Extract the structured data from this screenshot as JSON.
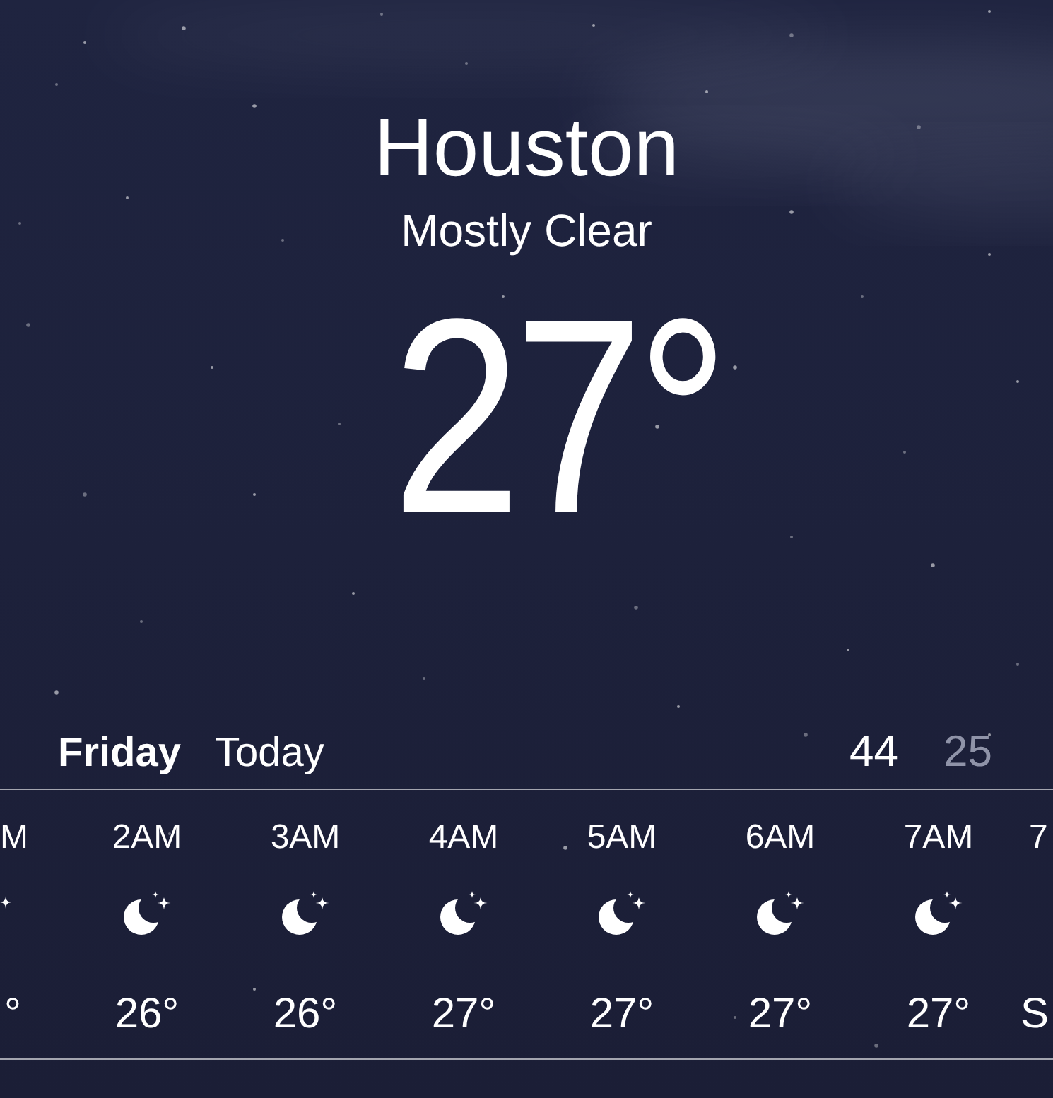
{
  "location": {
    "city": "Houston",
    "condition": "Mostly Clear",
    "temperature": "27°"
  },
  "today": {
    "day": "Friday",
    "label": "Today",
    "high": "44",
    "low": "25"
  },
  "hourly": [
    {
      "kind": "clipped_start",
      "time": "M",
      "temp": "°"
    },
    {
      "kind": "hour",
      "time": "2AM",
      "temp": "26°"
    },
    {
      "kind": "hour",
      "time": "3AM",
      "temp": "26°"
    },
    {
      "kind": "hour",
      "time": "4AM",
      "temp": "27°"
    },
    {
      "kind": "hour",
      "time": "5AM",
      "temp": "27°"
    },
    {
      "kind": "hour",
      "time": "6AM",
      "temp": "27°"
    },
    {
      "kind": "hour",
      "time": "7AM",
      "temp": "27°"
    },
    {
      "kind": "clipped_end",
      "time": "7",
      "temp": "S"
    }
  ]
}
